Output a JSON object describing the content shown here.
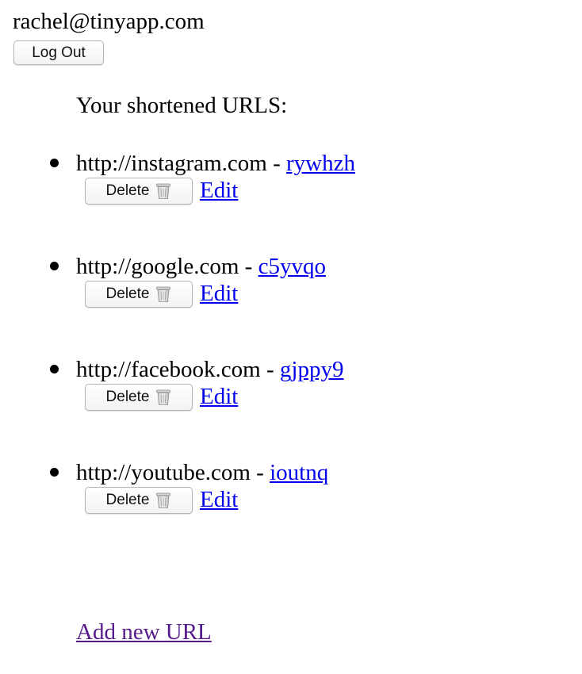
{
  "header": {
    "user_email": "rachel@tinyapp.com",
    "logout_label": "Log Out"
  },
  "main": {
    "heading": "Your shortened URLS:",
    "separator": " - ",
    "delete_label": "Delete",
    "delete_icon": "trash-can-icon",
    "edit_label": "Edit",
    "urls": [
      {
        "long_url": "http://instagram.com",
        "short_code": "rywhzh"
      },
      {
        "long_url": "http://google.com",
        "short_code": "c5yvqo"
      },
      {
        "long_url": "http://facebook.com",
        "short_code": "gjppy9"
      },
      {
        "long_url": "http://youtube.com",
        "short_code": "ioutnq"
      }
    ],
    "add_new_label": "Add new URL"
  },
  "colors": {
    "link": "#0000ee",
    "visited_link": "#551a8b",
    "text": "#000000",
    "background": "#ffffff"
  }
}
